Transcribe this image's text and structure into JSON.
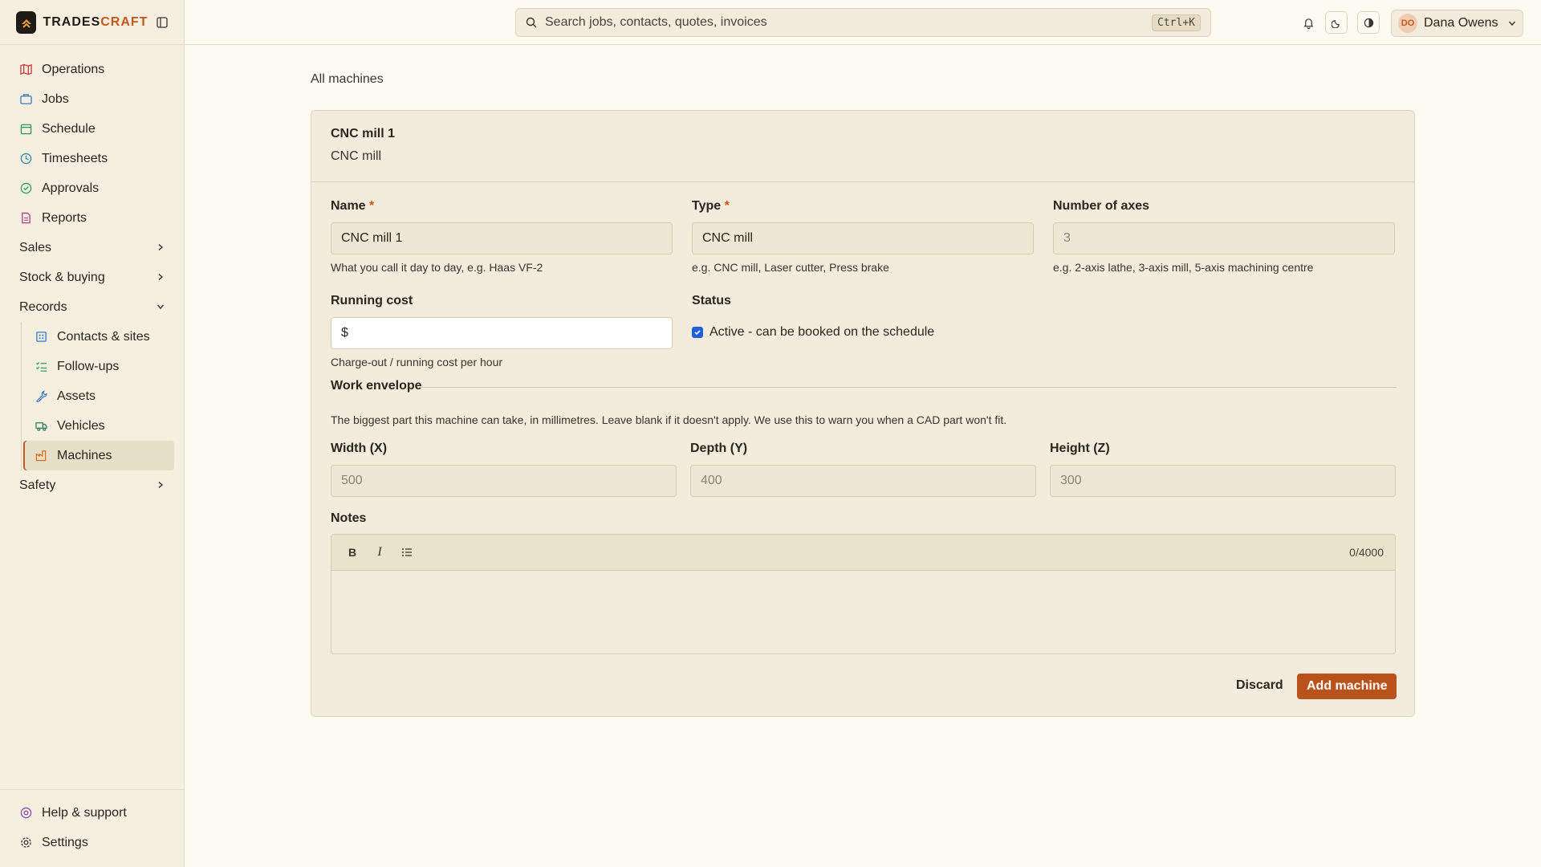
{
  "brand": {
    "name_part1": "TRADES",
    "name_part2": "CRAFT"
  },
  "sidebar": {
    "items": [
      {
        "label": "Operations",
        "icon": "map-icon",
        "color": "#c43c3c"
      },
      {
        "label": "Jobs",
        "icon": "briefcase-icon",
        "color": "#3c78c4"
      },
      {
        "label": "Schedule",
        "icon": "calendar-icon",
        "color": "#2e9a5a"
      },
      {
        "label": "Timesheets",
        "icon": "clock-icon",
        "color": "#2a8aa8"
      },
      {
        "label": "Approvals",
        "icon": "check-circle-icon",
        "color": "#2e9a5a"
      },
      {
        "label": "Reports",
        "icon": "document-icon",
        "color": "#b03c8a"
      }
    ],
    "groups": {
      "sales": "Sales",
      "stock": "Stock & buying",
      "records": "Records",
      "safety": "Safety"
    },
    "records_items": [
      {
        "label": "Contacts & sites",
        "icon": "building-icon"
      },
      {
        "label": "Follow-ups",
        "icon": "list-check-icon"
      },
      {
        "label": "Assets",
        "icon": "wrench-icon"
      },
      {
        "label": "Vehicles",
        "icon": "truck-icon"
      },
      {
        "label": "Machines",
        "icon": "factory-icon"
      }
    ],
    "bottom": {
      "help": "Help & support",
      "settings": "Settings"
    }
  },
  "topbar": {
    "search_placeholder": "Search jobs, contacts, quotes, invoices",
    "shortcut": "Ctrl+K",
    "user_initials": "DO",
    "user_name": "Dana Owens"
  },
  "breadcrumb": "All machines",
  "card": {
    "title": "CNC mill 1",
    "subtitle": "CNC mill"
  },
  "form": {
    "name_label": "Name",
    "name_value": "CNC mill 1",
    "name_hint": "What you call it day to day, e.g. Haas VF-2",
    "type_label": "Type",
    "type_value": "CNC mill",
    "type_hint": "e.g. CNC mill, Laser cutter, Press brake",
    "axes_label": "Number of axes",
    "axes_placeholder": "3",
    "axes_hint": "e.g. 2-axis lathe, 3-axis mill, 5-axis machining centre",
    "cost_label": "Running cost",
    "cost_prefix": "$",
    "cost_hint": "Charge-out / running cost per hour",
    "status_label": "Status",
    "status_checkbox": "Active - can be booked on the schedule",
    "required_mark": "*"
  },
  "envelope": {
    "title": "Work envelope",
    "description": "The biggest part this machine can take, in millimetres. Leave blank if it doesn't apply. We use this to warn you when a CAD part won't fit.",
    "width_label": "Width (X)",
    "width_placeholder": "500",
    "depth_label": "Depth (Y)",
    "depth_placeholder": "400",
    "height_label": "Height (Z)",
    "height_placeholder": "300"
  },
  "notes": {
    "label": "Notes",
    "counter": "0/4000"
  },
  "actions": {
    "discard": "Discard",
    "submit": "Add machine"
  }
}
